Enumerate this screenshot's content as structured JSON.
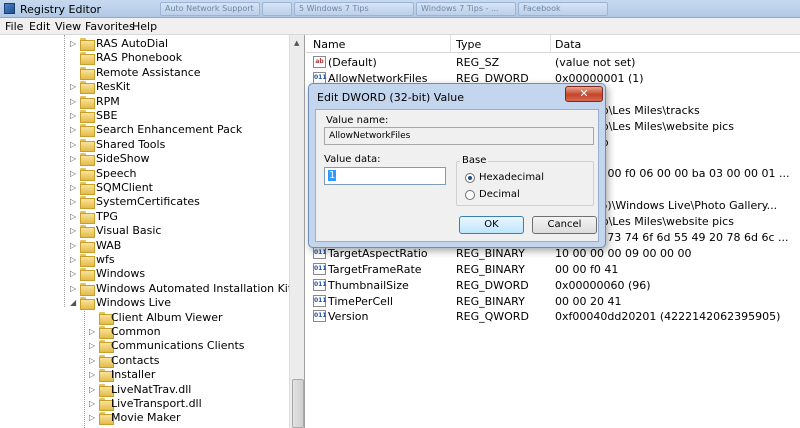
{
  "window": {
    "title": "Registry Editor",
    "background_tabs": [
      "Auto Network Support",
      "",
      "5 Windows 7 Tips",
      "Windows 7 Tips - ...",
      "Facebook"
    ]
  },
  "menu": [
    "File",
    "Edit",
    "View",
    "Favorites",
    "Help"
  ],
  "tree": {
    "items": [
      {
        "label": "RAS AutoDial",
        "expander": "▷"
      },
      {
        "label": "RAS Phonebook",
        "expander": ""
      },
      {
        "label": "Remote Assistance",
        "expander": ""
      },
      {
        "label": "ResKit",
        "expander": "▷"
      },
      {
        "label": "RPM",
        "expander": "▷"
      },
      {
        "label": "SBE",
        "expander": "▷"
      },
      {
        "label": "Search Enhancement Pack",
        "expander": "▷"
      },
      {
        "label": "Shared Tools",
        "expander": "▷"
      },
      {
        "label": "SideShow",
        "expander": "▷"
      },
      {
        "label": "Speech",
        "expander": "▷"
      },
      {
        "label": "SQMClient",
        "expander": "▷"
      },
      {
        "label": "SystemCertificates",
        "expander": "▷"
      },
      {
        "label": "TPG",
        "expander": "▷"
      },
      {
        "label": "Visual Basic",
        "expander": "▷"
      },
      {
        "label": "WAB",
        "expander": "▷"
      },
      {
        "label": "wfs",
        "expander": "▷"
      },
      {
        "label": "Windows",
        "expander": "▷"
      },
      {
        "label": "Windows Automated Installation Kit",
        "expander": "▷"
      },
      {
        "label": "Windows Live",
        "expander": "◢"
      }
    ],
    "children": [
      {
        "label": "Client Album Viewer",
        "expander": ""
      },
      {
        "label": "Common",
        "expander": "▷"
      },
      {
        "label": "Communications Clients",
        "expander": "▷"
      },
      {
        "label": "Contacts",
        "expander": "▷"
      },
      {
        "label": "Installer",
        "expander": "▷"
      },
      {
        "label": "LiveNatTrav.dll",
        "expander": "▷"
      },
      {
        "label": "LiveTransport.dll",
        "expander": "▷"
      },
      {
        "label": "Movie Maker",
        "expander": "▷"
      }
    ]
  },
  "list": {
    "headers": {
      "name": "Name",
      "type": "Type",
      "data": "Data"
    },
    "rows": [
      {
        "name": "(Default)",
        "type": "REG_SZ",
        "data": "(value not set)",
        "icon": "ab"
      },
      {
        "name": "AllowNetworkFiles",
        "type": "REG_DWORD",
        "data": "0x00000001 (1)",
        "icon": "011"
      },
      {
        "name": "",
        "type": "REG_DWORD",
        "data": "(0)",
        "icon": "011"
      },
      {
        "name": "",
        "type": "",
        "data": "r\\Desktop\\Les Miles\\tracks",
        "icon": "ab"
      },
      {
        "name": "",
        "type": "",
        "data": "r\\Desktop\\Les Miles\\website pics",
        "icon": "ab"
      },
      {
        "name": "",
        "type": "",
        "data": "r\\Desktop",
        "icon": "ab"
      },
      {
        "name": "",
        "type": "",
        "data": "(496)",
        "icon": "011"
      },
      {
        "name": "",
        "type": "",
        "data": "4d 00 00 00 f0 06 00 00 ba 03 00 00 01 ...",
        "icon": "011"
      },
      {
        "name": "",
        "type": "",
        "data": "",
        "icon": "011"
      },
      {
        "name": "",
        "type": "",
        "data": "Files (x86)\\Windows Live\\Photo Gallery...",
        "icon": "ab"
      },
      {
        "name": "",
        "type": "",
        "data": "r\\Desktop\\Les Miles\\website pics",
        "icon": "ab"
      },
      {
        "name": "",
        "type": "",
        "data": "ba 63 75 73 74 6f 6d 55 49 20 78 6d 6c ...",
        "icon": "011"
      },
      {
        "name": "TargetAspectRatio",
        "type": "REG_BINARY",
        "data": "10 00 00 00 09 00 00 00",
        "icon": "011"
      },
      {
        "name": "TargetFrameRate",
        "type": "REG_BINARY",
        "data": "00 00 f0 41",
        "icon": "011"
      },
      {
        "name": "ThumbnailSize",
        "type": "REG_DWORD",
        "data": "0x00000060 (96)",
        "icon": "011"
      },
      {
        "name": "TimePerCell",
        "type": "REG_BINARY",
        "data": "00 00 20 41",
        "icon": "011"
      },
      {
        "name": "Version",
        "type": "REG_QWORD",
        "data": "0xf00040dd20201 (4222142062395905)",
        "icon": "011"
      }
    ]
  },
  "dialog": {
    "title": "Edit DWORD (32-bit) Value",
    "close_glyph": "✕",
    "value_name_label": "Value name:",
    "value_name": "AllowNetworkFiles",
    "value_data_label": "Value data:",
    "value_data": "1",
    "base_label": "Base",
    "base_options": [
      "Hexadecimal",
      "Decimal"
    ],
    "base_selected": "Hexadecimal",
    "ok_label": "OK",
    "cancel_label": "Cancel"
  }
}
